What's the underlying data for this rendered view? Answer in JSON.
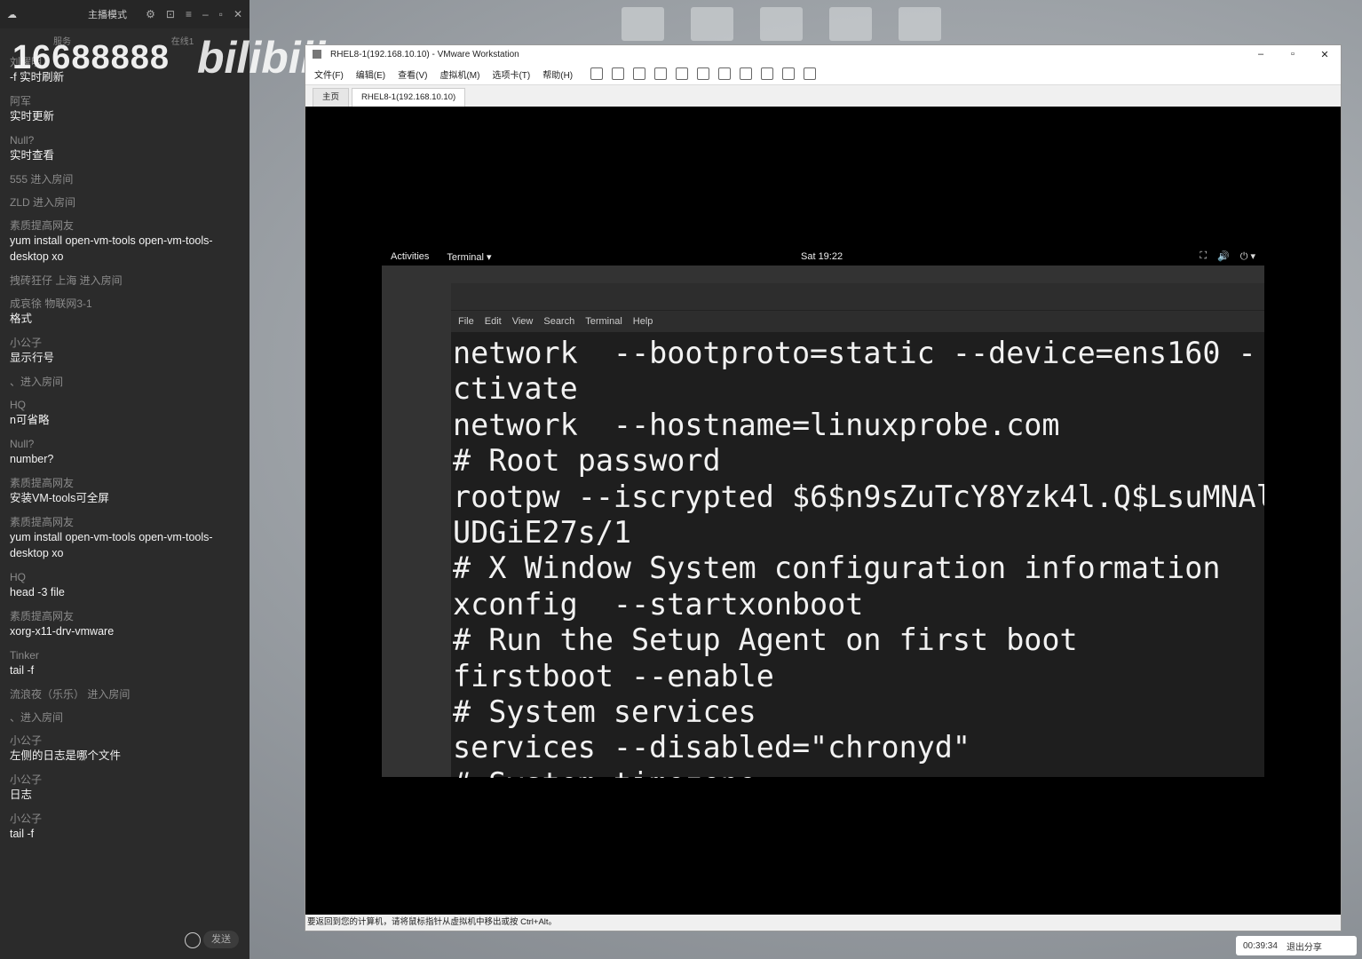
{
  "chat": {
    "title": "主播模式",
    "watermark_number": "16688888",
    "watermark_logo": "bilibili",
    "sub_left": "服务",
    "sub_right": "在线1",
    "messages": [
      {
        "user": "刘耀明",
        "text": "-f 实时刷新"
      },
      {
        "user": "阿军",
        "text": "实时更新"
      },
      {
        "user": "Null?",
        "text": "实时查看"
      },
      {
        "user": "555 进入房间",
        "text": ""
      },
      {
        "user": "ZLD 进入房间",
        "text": ""
      },
      {
        "user": "素质提高网友",
        "text": "yum install open-vm-tools open-vm-tools-desktop xo"
      },
      {
        "user": "拽砖狂仔 上海 进入房间",
        "text": ""
      },
      {
        "user": "成哀徐 物联网3-1",
        "text": "格式"
      },
      {
        "user": "小公子",
        "text": "显示行号"
      },
      {
        "user": "、进入房间",
        "text": ""
      },
      {
        "user": "HQ",
        "text": "n可省略"
      },
      {
        "user": "Null?",
        "text": "number?"
      },
      {
        "user": "素质提高网友",
        "text": "安装VM-tools可全屏"
      },
      {
        "user": "素质提高网友",
        "text": "yum install open-vm-tools open-vm-tools-desktop xo"
      },
      {
        "user": "HQ",
        "text": "head -3 file"
      },
      {
        "user": "素质提高网友",
        "text": "xorg-x11-drv-vmware"
      },
      {
        "user": "Tinker",
        "text": "tail -f"
      },
      {
        "user": "流浪夜（乐乐） 进入房间",
        "text": ""
      },
      {
        "user": "、进入房间",
        "text": ""
      },
      {
        "user": "小公子",
        "text": "左侧的日志是哪个文件"
      },
      {
        "user": "小公子",
        "text": "日志"
      },
      {
        "user": "小公子",
        "text": "tail -f"
      }
    ],
    "send_label": "发送"
  },
  "vmware": {
    "title": "RHEL8-1(192.168.10.10) - VMware Workstation",
    "menu": [
      "文件(F)",
      "编辑(E)",
      "查看(V)",
      "虚拟机(M)",
      "选项卡(T)",
      "帮助(H)"
    ],
    "tabs": [
      {
        "label": "主页"
      },
      {
        "label": "RHEL8-1(192.168.10.10)"
      }
    ],
    "status_text": "要返回到您的计算机，请将鼠标指针从虚拟机中移出或按 Ctrl+Alt。",
    "window_controls": [
      "–",
      "▫",
      "✕"
    ]
  },
  "gnome": {
    "activities": "Activities",
    "app_menu": "Terminal ▾",
    "clock": "Sat 19:22",
    "tray": [
      "⛶",
      "🔊",
      "⏻ ▾"
    ]
  },
  "terminal": {
    "menu": [
      "File",
      "Edit",
      "View",
      "Search",
      "Terminal",
      "Help"
    ],
    "lines": [
      "network  --bootproto=static --device=ens160 -",
      "ctivate",
      "network  --hostname=linuxprobe.com",
      "# Root password",
      "rootpw --iscrypted $6$n9sZuTcY8Yzk4l.Q$LsuMNAl",
      "UDGiE27s/1",
      "# X Window System configuration information",
      "xconfig  --startxonboot",
      "# Run the Setup Agent on first boot",
      "firstboot --enable",
      "# System services",
      "services --disabled=\"chronyd\"",
      "# System timezone"
    ]
  },
  "recorder": {
    "time": "00:39:34",
    "exit_label": "退出分享"
  }
}
